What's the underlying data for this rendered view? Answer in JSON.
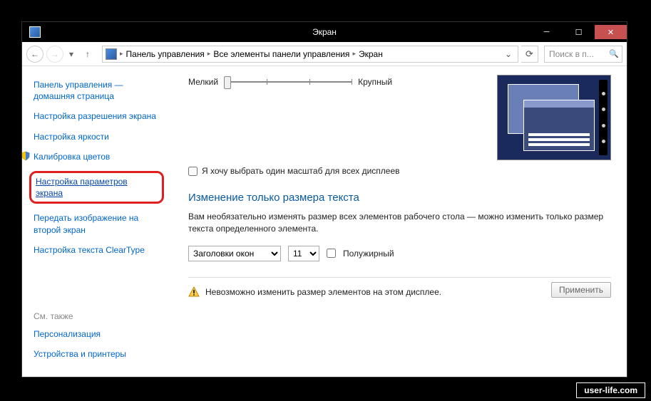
{
  "titlebar": {
    "title": "Экран"
  },
  "nav": {
    "breadcrumbs": [
      "Панель управления",
      "Все элементы панели управления",
      "Экран"
    ],
    "search_placeholder": "Поиск в п..."
  },
  "sidebar": {
    "links": [
      "Панель управления — домашняя страница",
      "Настройка разрешения экрана",
      "Настройка яркости",
      "Калибровка цветов",
      "Настройка параметров экрана",
      "Передать изображение на второй экран",
      "Настройка текста ClearType"
    ],
    "see_also_header": "См. также",
    "see_also": [
      "Персонализация",
      "Устройства и принтеры"
    ]
  },
  "main": {
    "slider": {
      "min_label": "Мелкий",
      "max_label": "Крупный"
    },
    "checkbox_label": "Я хочу выбрать один масштаб для всех дисплеев",
    "section_title": "Изменение только размера текста",
    "description": "Вам необязательно изменять размер всех элементов рабочего стола — можно изменить только размер текста определенного элемента.",
    "element_select": "Заголовки окон",
    "size_select": "11",
    "bold_label": "Полужирный",
    "warning": "Невозможно изменить размер элементов на этом дисплее.",
    "apply_button": "Применить"
  },
  "watermark": "user-life.com"
}
